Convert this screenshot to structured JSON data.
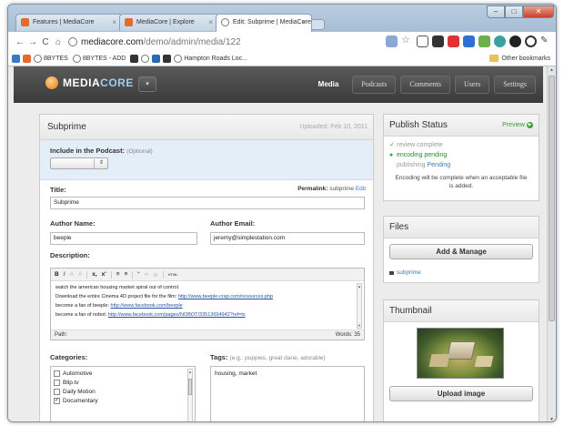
{
  "browser": {
    "tabs": [
      {
        "label": "Features | MediaCore"
      },
      {
        "label": "MediaCore | Explore"
      },
      {
        "label": "Edit: Subprime | MediaCore"
      }
    ],
    "url_host": "mediacore.com",
    "url_path": "/demo/admin/media/122",
    "bookmarks": [
      "8BYTES",
      "8BYTES - ADD",
      "Hampton Roads Loc..."
    ],
    "other_bookmarks": "Other bookmarks"
  },
  "app": {
    "logo_main": "MEDIA",
    "logo_accent": "CORE",
    "nav": [
      "Media",
      "Podcasts",
      "Comments",
      "Users",
      "Settings"
    ]
  },
  "media": {
    "title": "Subprime",
    "uploaded": "Uploaded: Feb 10, 2011",
    "podcast_label": "Include in the Podcast:",
    "podcast_optional": "(Optional)",
    "title_label": "Title:",
    "permalink_label": "Permalink:",
    "permalink_value": "subprime",
    "permalink_edit": "Edit",
    "title_value": "Subprime",
    "author_name_label": "Author Name:",
    "author_name_value": "beeple",
    "author_email_label": "Author Email:",
    "author_email_value": "jeremy@simplestation.com",
    "description_label": "Description:",
    "editor_buttons": [
      "B",
      "I",
      "A",
      "A",
      "x,",
      "x'",
      "≡",
      "≡",
      "“",
      "∞",
      "⊘",
      "HTML"
    ],
    "description_lines": [
      {
        "text": "watch the american housing market spiral out of control.",
        "link": ""
      },
      {
        "text": "Download the entire Cinema 4D project file for the film: ",
        "link": "http://www.beeple-crap.com/resources.php"
      },
      {
        "text": "become a fan of beeple: ",
        "link": "http://www.facebook.com/beeple"
      },
      {
        "text": "become a fan of nobot: ",
        "link": "http://www.facebook.com/pages/NOBOT/33513694942?ref=ts"
      }
    ],
    "path_label": "Path:",
    "words": "Words: 35",
    "categories_label": "Categories:",
    "categories": [
      {
        "name": "Automotive",
        "checked": false
      },
      {
        "name": "Blip.tv",
        "checked": false
      },
      {
        "name": "Daily Motion",
        "checked": false
      },
      {
        "name": "Documentary",
        "checked": true
      }
    ],
    "tags_label": "Tags:",
    "tags_hint": "(e.g.: puppies, great dane, adorable)",
    "tags_value": "housing, market"
  },
  "publish": {
    "title": "Publish Status",
    "preview": "Preview",
    "review": "review complete",
    "encoding": "encoding pending",
    "publishing_label": "publishing",
    "publishing_value": "Pending",
    "note": "Encoding will be complete when an acceptable file is added."
  },
  "files": {
    "title": "Files",
    "button": "Add & Manage",
    "file": "subprime"
  },
  "thumbnail": {
    "title": "Thumbnail",
    "button": "Upload image"
  },
  "colors": {
    "accent_green": "#3aa03a",
    "link_blue": "#3a7bbf",
    "header_dark": "#3a3a3a",
    "podcast_bg": "#e4eef8"
  }
}
